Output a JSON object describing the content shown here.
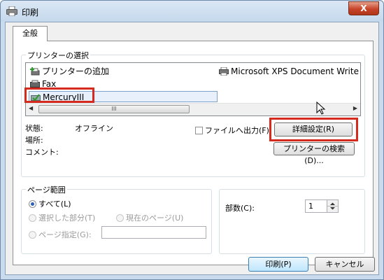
{
  "window": {
    "title": "印刷",
    "close_glyph": "X"
  },
  "tabs": [
    {
      "label": "全般"
    }
  ],
  "printer_selection": {
    "group_title": "プリンターの選択",
    "items": [
      {
        "label": "プリンターの追加",
        "icon": "add-printer-icon"
      },
      {
        "label": "Microsoft XPS Document Write",
        "icon": "printer-icon"
      },
      {
        "label": "Fax",
        "icon": "fax-icon"
      },
      {
        "label": "MercuryIII",
        "icon": "default-printer-check-icon",
        "selected": true
      }
    ],
    "scroll": {
      "left_arrow": "◀",
      "thumb": "III",
      "right_arrow": "▶"
    },
    "status_label": "状態:",
    "status_value": "オフライン",
    "location_label": "場所:",
    "location_value": "",
    "comment_label": "コメント:",
    "comment_value": "",
    "print_to_file_label": "ファイルへ出力(F)",
    "print_to_file_checked": false,
    "preferences_button": "詳細設定(R)",
    "find_printer_button": "プリンターの検索(D)..."
  },
  "page_range": {
    "group_title": "ページ範囲",
    "all_label": "すべて(L)",
    "selection_label": "選択した部分(T)",
    "current_page_label": "現在のページ(U)",
    "pages_label": "ページ指定(G):",
    "pages_value": ""
  },
  "copies": {
    "label": "部数(C):",
    "value": "1"
  },
  "footer": {
    "print_button": "印刷(P)",
    "cancel_button": "キャンセル"
  },
  "colors": {
    "highlight": "#d52b1e",
    "selection_border": "#7da2ce"
  }
}
